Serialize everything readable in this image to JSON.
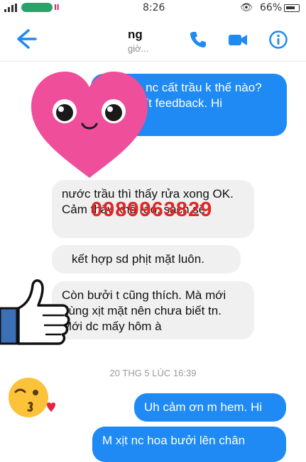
{
  "status_bar": {
    "time": "8:26",
    "battery": "66%",
    "carrier_text": "ll"
  },
  "header": {
    "contact_name": "ng",
    "active_status": "giờ..."
  },
  "overlay": {
    "phone_number": "0989963829"
  },
  "messages": [
    {
      "side": "out",
      "text": "bưởi và nc cất trầu k thế nào? Cho xin ít feedback. Hi"
    },
    {
      "side": "in",
      "text": "nước trầu thì thấy rửa xong OK. Cảm thấy khô ráo, sạch sẽ"
    },
    {
      "side": "in",
      "text": "kết hợp sd phịt mặt luôn."
    },
    {
      "side": "in",
      "text": "Còn bưởi t cũng thích. Mà mới dùng xịt mặt nên chưa biết tn. Mới dc mấy hôm à"
    },
    {
      "side": "out",
      "text": "Uh cảm ơn m hem. Hi"
    },
    {
      "side": "out",
      "text": "M xịt nc hoa bưởi lên chân"
    }
  ],
  "timestamp": "20 THG 5 LÚC 16:39",
  "colors": {
    "messenger_blue": "#1f8af3",
    "incoming_gray": "#f1f0f0",
    "phone_red": "#e32626",
    "heart_pink": "#ee4e9a"
  }
}
